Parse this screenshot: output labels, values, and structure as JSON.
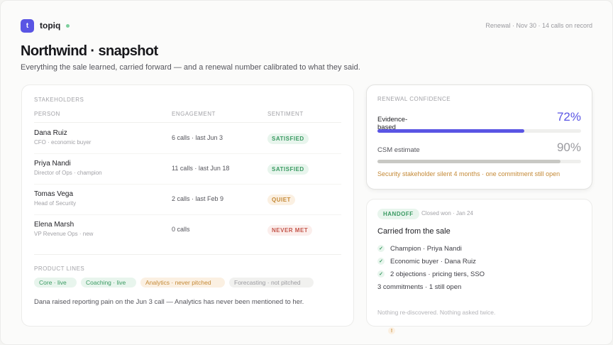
{
  "app": {
    "logo_letter": "t",
    "brand": "topiq",
    "meta": "Renewal · Nov 30 · 14 calls on record"
  },
  "page": {
    "title": "Northwind · snapshot",
    "subtitle": "Everything the sale learned, carried forward — and a renewal number calibrated to what they said."
  },
  "stakeholders": {
    "label": "Stakeholders",
    "columns": [
      "Person",
      "Engagement",
      "Sentiment"
    ],
    "rows": [
      {
        "name": "Dana Ruiz",
        "role": "CFO · economic buyer",
        "engagement": "6 calls · last Jun 3",
        "sentiment": "Satisfied"
      },
      {
        "name": "Priya Nandi",
        "role": "Director of Ops · champion",
        "engagement": "11 calls · last Jun 18",
        "sentiment": "Satisfied"
      },
      {
        "name": "Tomas Vega",
        "role": "Head of Security",
        "engagement": "2 calls · last Feb 9",
        "sentiment": "Quiet"
      },
      {
        "name": "Elena Marsh",
        "role": "VP Revenue Ops · new",
        "engagement": "0 calls",
        "sentiment": "Never met"
      }
    ],
    "product_lines_label": "Product lines",
    "product_lines": [
      {
        "text": "Core · live",
        "status": "live"
      },
      {
        "text": "Coaching · live",
        "status": "live"
      },
      {
        "text": "Analytics · never pitched",
        "status": "never"
      },
      {
        "text": "Forecasting · not pitched",
        "status": "not"
      }
    ],
    "note": "Dana raised reporting pain on the Jun 3 call — Analytics has never been mentioned to her."
  },
  "renewal": {
    "label": "Renewal confidence",
    "metrics": [
      {
        "label": "Evidence-based",
        "value": "72%",
        "fraction": 0.72
      },
      {
        "label": "CSM estimate",
        "value": "90%",
        "fraction": 0.9
      }
    ],
    "warning": "Security stakeholder silent 4 months · one commitment still open"
  },
  "handoff": {
    "badge": "Handoff",
    "status": "Closed won · Jan 24",
    "title": "Carried from the sale",
    "items": [
      {
        "text": "Champion · Priya Nandi",
        "icon": "check-icon",
        "glyph": "✓"
      },
      {
        "text": "Economic buyer · Dana Ruiz",
        "icon": "check-icon",
        "glyph": "✓"
      },
      {
        "text": "2 objections · pricing tiers, SSO",
        "icon": "check-icon",
        "glyph": "✓"
      },
      {
        "text": "3 commitments · 1 still open",
        "icon": "alert-icon",
        "glyph": "!"
      }
    ],
    "footer": "Nothing re-discovered. Nothing asked twice."
  },
  "colors": {
    "accent": "#5a55e4",
    "positive": "#3a9a62",
    "warning": "#c48936",
    "negative": "#c4564b"
  }
}
